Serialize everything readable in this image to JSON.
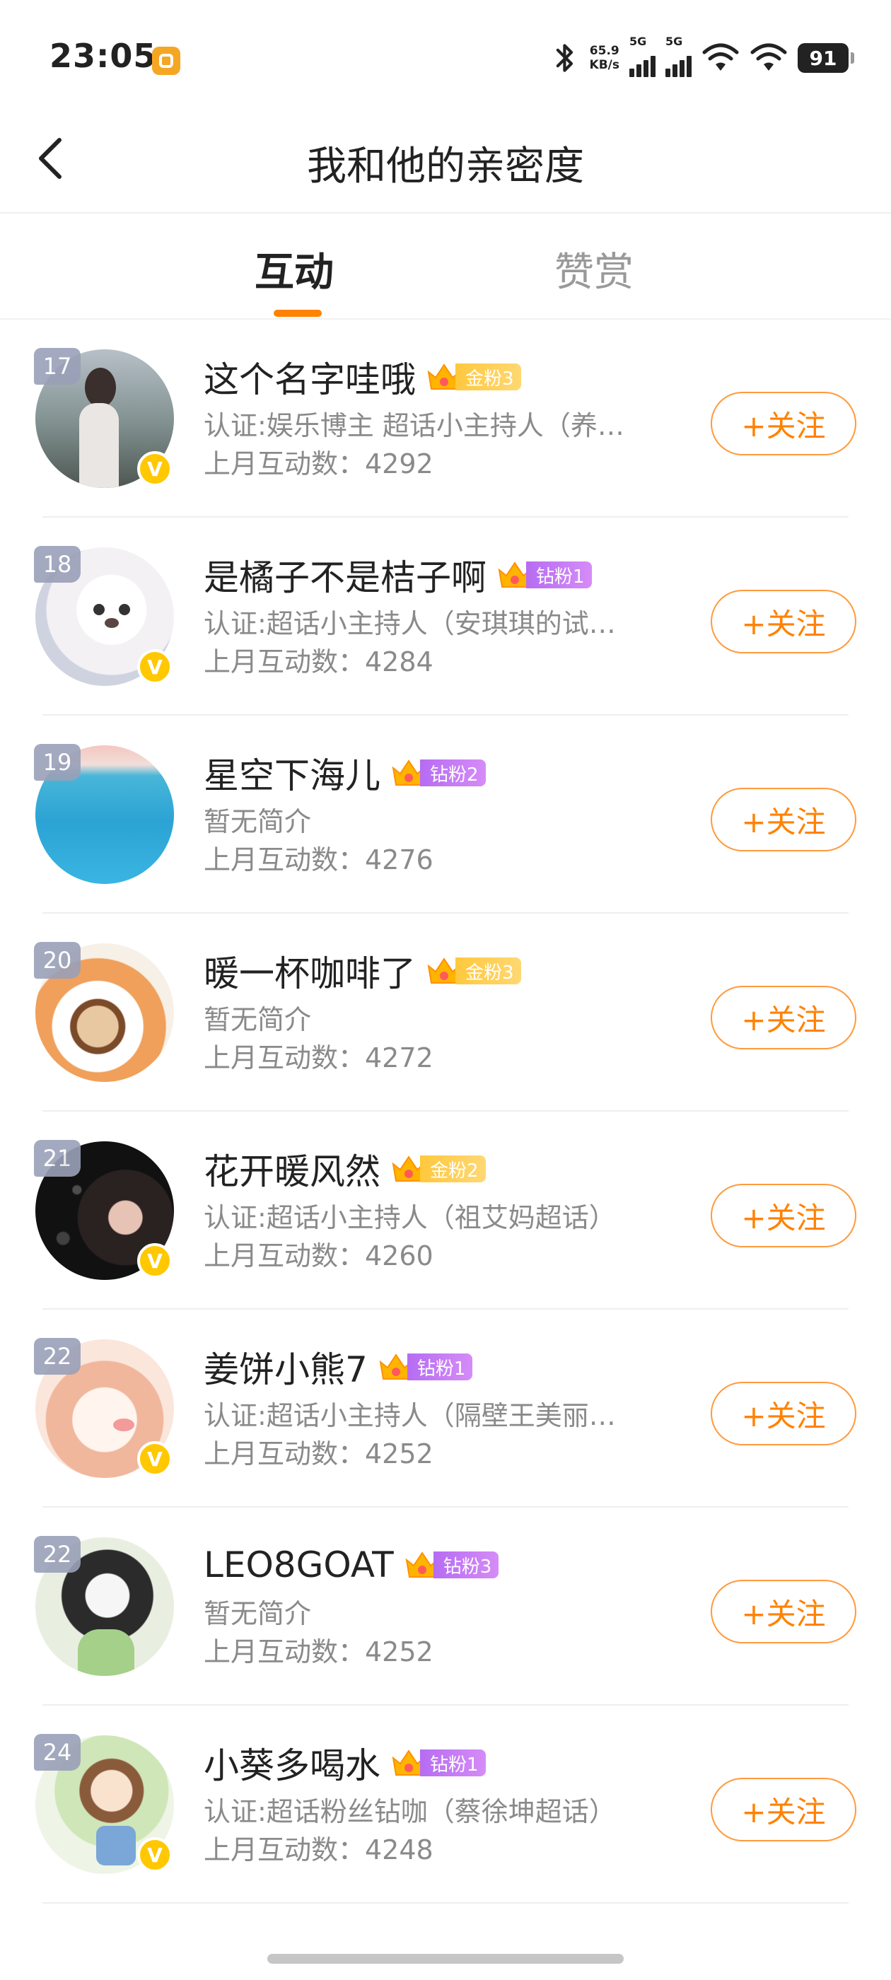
{
  "status_bar": {
    "time": "23:05",
    "net_speed_value": "65.9",
    "net_speed_unit": "KB/s",
    "signal1_label": "5G",
    "signal2_label": "5G",
    "battery": "91"
  },
  "header": {
    "title": "我和他的亲密度"
  },
  "tabs": [
    {
      "label": "互动",
      "active": true
    },
    {
      "label": "赞赏",
      "active": false
    }
  ],
  "follow_label": "+关注",
  "users": [
    {
      "rank": "17",
      "name": "这个名字哇哦",
      "badge": "金粉3",
      "badge_type": "gold",
      "verified": true,
      "desc": "认证:娱乐博主 超话小主持人（养…",
      "count": "上月互动数：4292"
    },
    {
      "rank": "18",
      "name": "是橘子不是桔子啊",
      "badge": "钻粉1",
      "badge_type": "diamond",
      "verified": true,
      "desc": "认证:超话小主持人（安琪琪的试…",
      "count": "上月互动数：4284"
    },
    {
      "rank": "19",
      "name": "星空下海儿",
      "badge": "钻粉2",
      "badge_type": "diamond",
      "verified": false,
      "desc": "暂无简介",
      "count": "上月互动数：4276"
    },
    {
      "rank": "20",
      "name": "暖一杯咖啡了",
      "badge": "金粉3",
      "badge_type": "gold",
      "verified": false,
      "desc": "暂无简介",
      "count": "上月互动数：4272"
    },
    {
      "rank": "21",
      "name": "花开暖风然",
      "badge": "金粉2",
      "badge_type": "gold",
      "verified": true,
      "desc": "认证:超话小主持人（祖艾妈超话）",
      "count": "上月互动数：4260"
    },
    {
      "rank": "22",
      "name": "姜饼小熊7",
      "badge": "钻粉1",
      "badge_type": "diamond",
      "verified": true,
      "desc": "认证:超话小主持人（隔壁王美丽…",
      "count": "上月互动数：4252"
    },
    {
      "rank": "22",
      "name": "LEO8GOAT",
      "badge": "钻粉3",
      "badge_type": "diamond",
      "verified": false,
      "desc": "暂无简介",
      "count": "上月互动数：4252"
    },
    {
      "rank": "24",
      "name": "小葵多喝水",
      "badge": "钻粉1",
      "badge_type": "diamond",
      "verified": true,
      "desc": "认证:超话粉丝钻咖（蔡徐坤超话）",
      "count": "上月互动数：4248"
    }
  ],
  "colors": {
    "accent": "#ff8200",
    "gold_badge": "#ffc83d",
    "diamond_badge": "#b66cf2",
    "verified": "#ffc800"
  }
}
